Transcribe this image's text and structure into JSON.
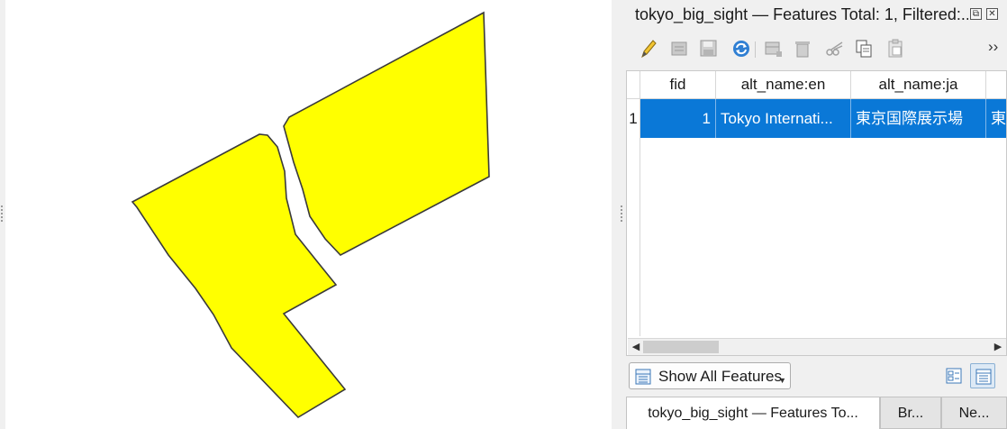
{
  "panel": {
    "title": "tokyo_big_sight — Features Total: 1, Filtered:...",
    "float_glyph": "⧉",
    "close_glyph": "✕"
  },
  "toolbar": {
    "icons": [
      "pencil-icon",
      "multi-edit-icon",
      "save-edits-icon",
      "reload-icon",
      "add-feature-icon",
      "delete-feature-icon",
      "cut-icon",
      "copy-icon",
      "paste-icon"
    ],
    "more_label": "››"
  },
  "table": {
    "columns": [
      "fid",
      "alt_name:en",
      "alt_name:ja"
    ],
    "rows": [
      {
        "row_number": "1",
        "fid": "1",
        "alt_name_en": "Tokyo Internati...",
        "alt_name_ja": "東京国際展示場",
        "next_col_partial": "東"
      }
    ],
    "scroll_left": "◀",
    "scroll_right": "▶"
  },
  "filter": {
    "show_features_label": "Show All Features",
    "dropdown_glyph": "▼"
  },
  "tabs": [
    {
      "label": "tokyo_big_sight — Features To...",
      "active": true
    },
    {
      "label": "Br...",
      "active": false
    },
    {
      "label": "Ne...",
      "active": false
    }
  ],
  "colors": {
    "feature_fill": "#ffff00",
    "feature_stroke": "#3a3a3a",
    "selection": "#0a78d7"
  }
}
